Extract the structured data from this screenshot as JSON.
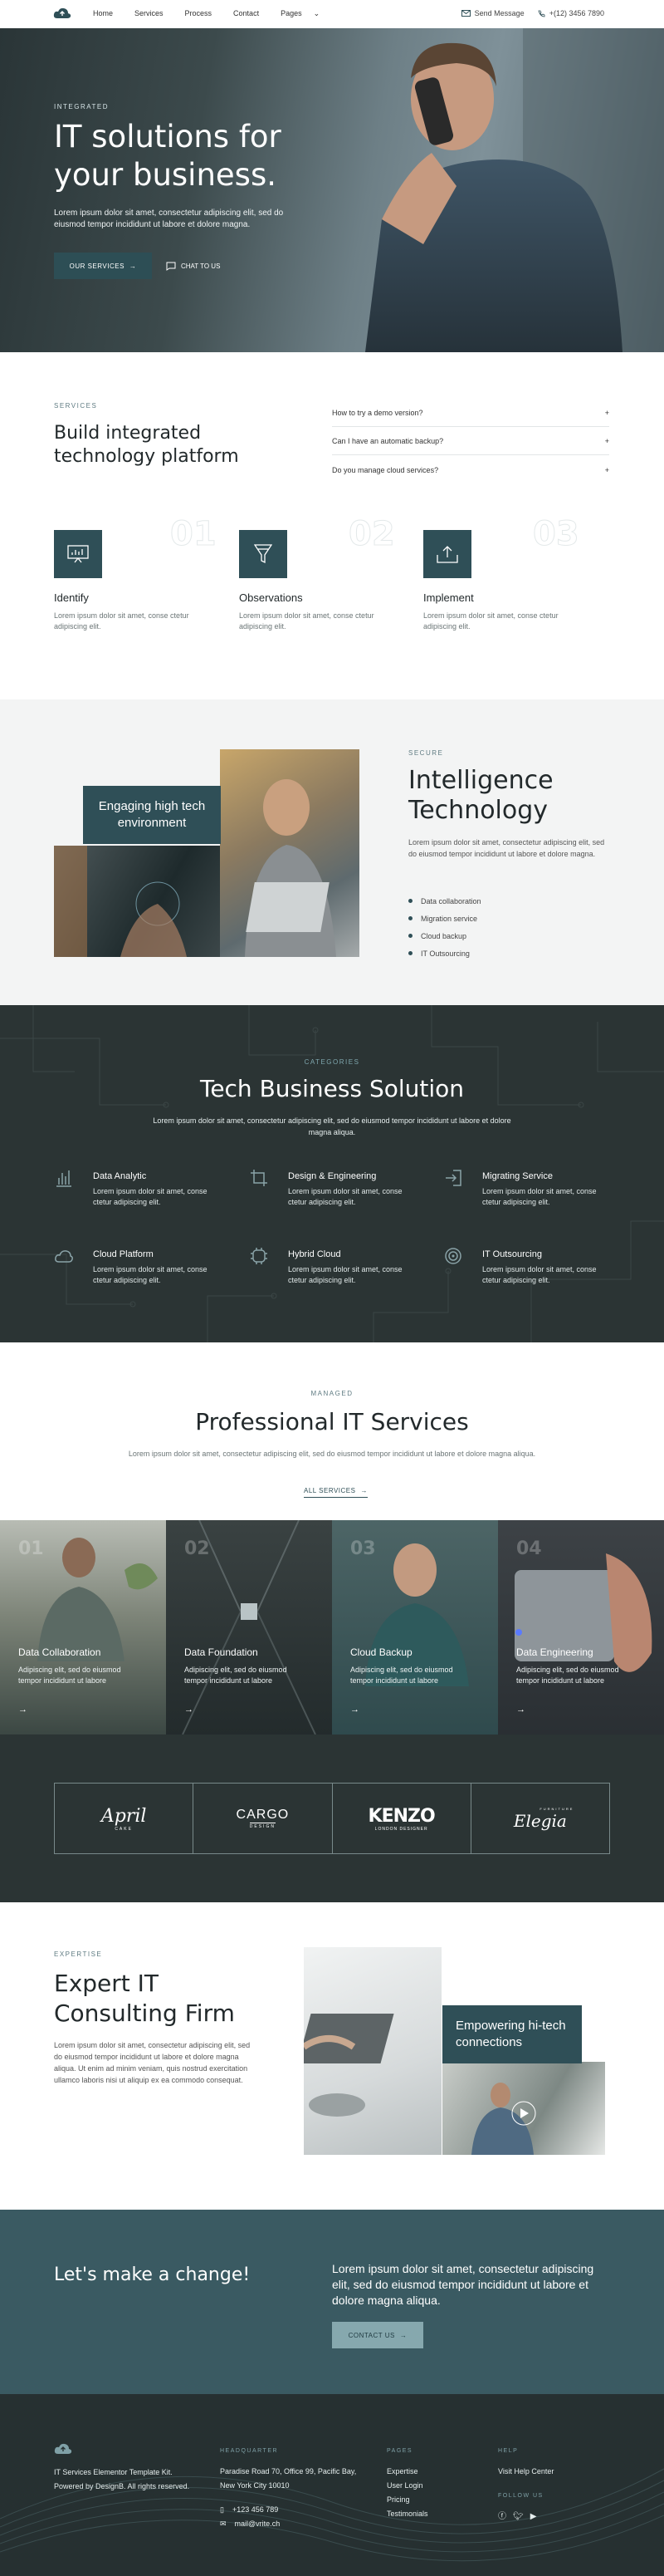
{
  "nav": {
    "links": [
      "Home",
      "Services",
      "Process",
      "Contact",
      "Pages"
    ],
    "send_message": "Send Message",
    "phone": "+(12) 3456 7890"
  },
  "hero": {
    "tag": "INTEGRATED",
    "title": "IT solutions for your business.",
    "desc": "Lorem ipsum dolor sit amet, consectetur adipiscing elit, sed do eiusmod tempor incididunt ut labore et dolore magna.",
    "btn_services": "OUR SERVICES",
    "btn_chat": "CHAT TO US"
  },
  "services": {
    "tag": "SERVICES",
    "title": "Build integrated technology platform",
    "faqs": [
      "How to try a demo version?",
      "Can I have an automatic backup?",
      "Do you manage cloud services?"
    ],
    "features": [
      {
        "num": "01",
        "name": "Identify",
        "text": "Lorem ipsum dolor sit amet, conse ctetur adipiscing elit."
      },
      {
        "num": "02",
        "name": "Observations",
        "text": "Lorem ipsum dolor sit amet, conse ctetur adipiscing elit."
      },
      {
        "num": "03",
        "name": "Implement",
        "text": "Lorem ipsum dolor sit amet, conse ctetur adipiscing elit."
      }
    ]
  },
  "intel": {
    "badge": "Engaging high tech environment",
    "tag": "SECURE",
    "title": "Intelligence Technology",
    "desc": "Lorem ipsum dolor sit amet, consectetur adipiscing elit, sed do eiusmod tempor incididunt ut labore et dolore magna.",
    "list": [
      "Data collaboration",
      "Migration service",
      "Cloud backup",
      "IT Outsourcing"
    ]
  },
  "tech": {
    "tag": "CATEGORIES",
    "title": "Tech Business Solution",
    "desc": "Lorem ipsum dolor sit amet, consectetur adipiscing elit, sed do eiusmod tempor incididunt ut labore et dolore magna aliqua.",
    "items": [
      {
        "name": "Data Analytic",
        "text": "Lorem ipsum dolor sit amet, conse ctetur adipiscing elit."
      },
      {
        "name": "Design & Engineering",
        "text": "Lorem ipsum dolor sit amet, conse ctetur adipiscing elit."
      },
      {
        "name": "Migrating Service",
        "text": "Lorem ipsum dolor sit amet, conse ctetur adipiscing elit."
      },
      {
        "name": "Cloud Platform",
        "text": "Lorem ipsum dolor sit amet, conse ctetur adipiscing elit."
      },
      {
        "name": "Hybrid Cloud",
        "text": "Lorem ipsum dolor sit amet, conse ctetur adipiscing elit."
      },
      {
        "name": "IT Outsourcing",
        "text": "Lorem ipsum dolor sit amet, conse ctetur adipiscing elit."
      }
    ]
  },
  "pro": {
    "tag": "MANAGED",
    "title": "Professional IT Services",
    "desc": "Lorem ipsum dolor sit amet, consectetur adipiscing elit, sed do eiusmod tempor incididunt ut labore et dolore magna aliqua.",
    "all_services": "ALL SERVICES",
    "tiles": [
      {
        "num": "01",
        "name": "Data Collaboration",
        "text": "Adipiscing elit, sed do eiusmod tempor incididunt ut labore"
      },
      {
        "num": "02",
        "name": "Data Foundation",
        "text": "Adipiscing elit, sed do eiusmod tempor incididunt ut labore"
      },
      {
        "num": "03",
        "name": "Cloud Backup",
        "text": "Adipiscing elit, sed do eiusmod tempor incididunt ut labore"
      },
      {
        "num": "04",
        "name": "Data Engineering",
        "text": "Adipiscing elit, sed do eiusmod tempor incididunt ut labore"
      }
    ]
  },
  "brands": {
    "april": "April",
    "april_sub": "CAKE",
    "cargo": "CARGO",
    "cargo_sub": "DESIGN",
    "kenzo": "KENZO",
    "kenzo_sub": "LONDON DESIGNER",
    "elegia": "Elegia",
    "elegia_sub": "FURNITURE"
  },
  "expert": {
    "tag": "EXPERTISE",
    "title": "Expert IT Consulting Firm",
    "desc": "Lorem ipsum dolor sit amet, consectetur adipiscing elit, sed do eiusmod tempor incididunt ut labore et dolore magna aliqua. Ut enim ad minim veniam, quis nostrud exercitation ullamco laboris nisi ut aliquip ex ea commodo consequat.",
    "badge": "Empowering hi-tech connections"
  },
  "cta": {
    "title": "Let's make a change!",
    "desc": "Lorem ipsum dolor sit amet, consectetur adipiscing elit, sed do eiusmod tempor incididunt ut labore et dolore magna aliqua.",
    "btn": "CONTACT US"
  },
  "footer": {
    "about": "IT Services Elementor Template Kit. Powered by DesignB. All rights reserved.",
    "hq_head": "HEADQUARTER",
    "address": "Paradise Road 70, Office 99, Pacific Bay, New York City 10010",
    "phone": "+123 456 789",
    "email": "mail@vrite.ch",
    "pages_head": "PAGES",
    "pages": [
      "Expertise",
      "User Login",
      "Pricing",
      "Testimonials"
    ],
    "help_head": "HELP",
    "help_link": "Visit Help Center",
    "follow_head": "FOLLOW US"
  }
}
